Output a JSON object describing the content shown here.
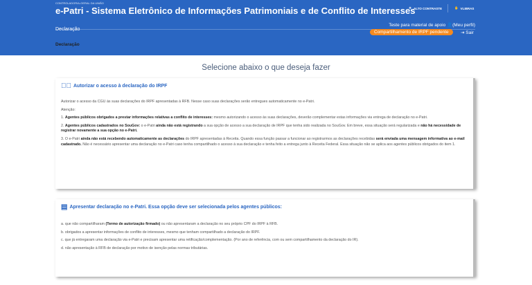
{
  "header": {
    "org": "CONTROLADORIA-GERAL DA UNIÃO",
    "title": "e-Patri - Sistema Eletrônico de Informações Patrimoniais e de Conflito de Interesses",
    "high_contrast": "ALTO CONTRASTE",
    "vlibras": "VLIBRAS",
    "nav": "Declaração",
    "user": "Teste para material de apoio",
    "profile": "(Meu perfil)",
    "pending": "Compartilhamento de IRPF pendente",
    "logout": "Sair"
  },
  "breadcrumb": "Declaração",
  "heading": "Selecione abaixo o que deseja fazer",
  "card1": {
    "title": "Autorizar o acesso à declaração do IRPF",
    "intro": "Autorizar o acesso da CGU às suas declarações do IRPF apresentadas à RFB. Nesse caso suas declarações serão entregues automaticamente no e-Patri.",
    "attention": "Atenção:",
    "i1a": "1. ",
    "i1b": "Agentes públicos obrigados a prestar informações relativas a conflito de interesses:",
    "i1c": " mesmo autorizando o acesso às suas declarações, deverão complementar estas informações via entrega de declaração no e-Patri.",
    "i2a": "2. ",
    "i2b": "Agentes públicos cadastrados no SouGov:",
    "i2c": " o e-Patri ",
    "i2d": "ainda não está registrando",
    "i2e": " a sua opção de acesso a sua declaração de IRPF que tenha sido realizada no SouGov. Em breve, essa situação será regularizada e ",
    "i2f": "não há necessidade de registrar novamente a sua opção no e-Patri.",
    "i3a": "3. O e-Patri ",
    "i3b": "ainda não está recebendo automaticamente as declarações",
    "i3c": " do IRPF apresentadas à Receita. Quando essa função passar a funcionar ao registrarmos as declarações recebidas ",
    "i3d": "será enviada uma mensagem informativa ao e-mail cadastrado.",
    "i3e": " Não é necessário apresentar uma declaração no e-Patri caso tenha compartilhado o acesso à sua declaração e tenha feito a entrega junto à Receita Federal. Essa situação não se aplica aos agentes públicos obrigados do item 1."
  },
  "card2": {
    "title": "Apresentar declaração no e-Patri. Essa opção deve ser selecionada pelos agentes públicos:",
    "a1": "a. que não compartilharam ",
    "a2": "(Termo de autorização firmado)",
    "a3": " ou não apresentaram a declaração no seu próprio CPF do IRPF à RFB.",
    "b": "b. obrigados a apresentar informações de conflito de interesses, mesmo que tenham compartilhado a declaração do IRPF.",
    "c": "c. que já entregaram uma declaração via e-Patri e precisam apresentar uma retificação/complementação. (Por ano de referência, com ou sem compartilhamento da declaração do IR).",
    "d": "d. não apresentação à RFB de declaração por motivo de isenção pelas normas tributárias."
  }
}
